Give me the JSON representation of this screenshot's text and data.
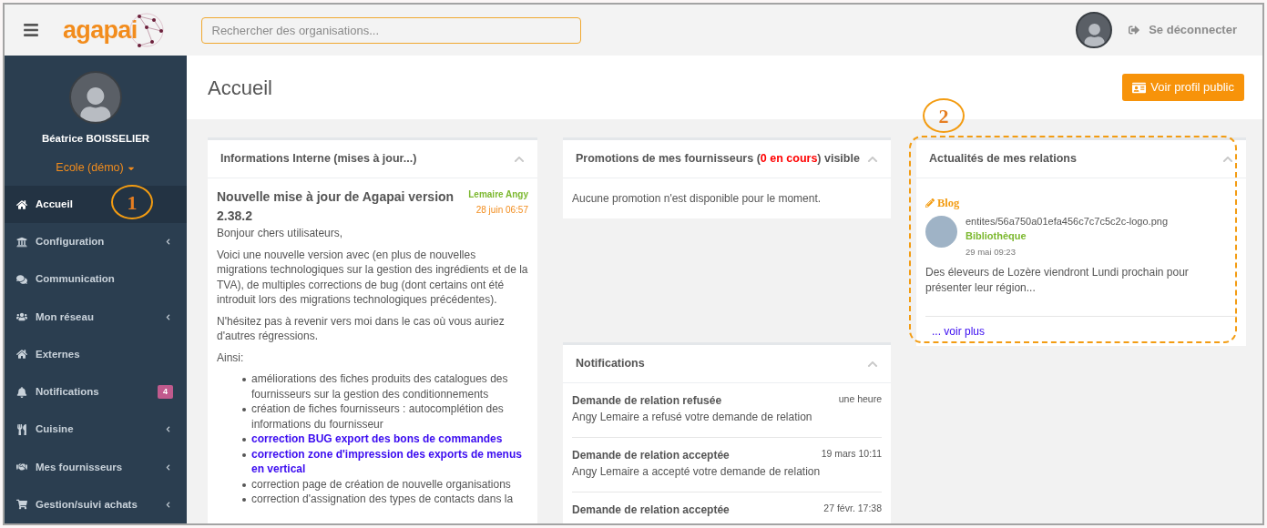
{
  "header": {
    "logo": "agapai",
    "search": {
      "placeholder": "Rechercher des organisations..."
    },
    "logout": "Se déconnecter"
  },
  "sidebar": {
    "user_name": "Béatrice BOISSELIER",
    "organisation": "Ecole (démo)",
    "items": [
      {
        "label": "Accueil",
        "selected": true,
        "expandable": false
      },
      {
        "label": "Configuration",
        "selected": false,
        "expandable": true
      },
      {
        "label": "Communication",
        "selected": false,
        "expandable": false
      },
      {
        "label": "Mon réseau",
        "selected": false,
        "expandable": true
      },
      {
        "label": "Externes",
        "selected": false,
        "expandable": false
      },
      {
        "label": "Notifications",
        "selected": false,
        "expandable": false,
        "badge": "4"
      },
      {
        "label": "Cuisine",
        "selected": false,
        "expandable": true
      },
      {
        "label": "Mes fournisseurs",
        "selected": false,
        "expandable": true
      },
      {
        "label": "Gestion/suivi achats",
        "selected": false,
        "expandable": true
      }
    ]
  },
  "page": {
    "title": "Accueil",
    "public_profile_button": "Voir profil public"
  },
  "internal_info": {
    "title": "Informations Interne (mises à jour...)",
    "post": {
      "title": "Nouvelle mise à jour de Agapai version 2.38.2",
      "author": "Lemaire Angy",
      "date": "28 juin 06:57",
      "paragraphs": [
        "Bonjour chers utilisateurs,",
        "Voici une nouvelle version avec (en plus de nouvelles migrations technologiques sur la gestion des ingrédients et de la TVA), de multiples corrections de bug (dont certains ont été introduit lors des migrations technologiques précédentes).",
        "N'hésitez pas à revenir vers moi dans le cas où vous auriez d'autres régressions.",
        "Ainsi:"
      ],
      "bullets": [
        {
          "text": "améliorations des fiches produits des catalogues des fournisseurs sur la gestion des conditionnements",
          "highlighted": false
        },
        {
          "text": "création de fiches fournisseurs : autocomplétion des informations du fournisseur",
          "highlighted": false
        },
        {
          "text": "correction BUG export des bons de commandes",
          "highlighted": true
        },
        {
          "text": "correction zone d'impression des exports de menus en vertical",
          "highlighted": true
        },
        {
          "text": "correction page de création de nouvelle organisations",
          "highlighted": false
        },
        {
          "text": "correction d'assignation des types de contacts dans la",
          "highlighted": false
        }
      ]
    }
  },
  "promotions": {
    "title": [
      {
        "text": "Promotions de mes fournisseurs (",
        "kind": "plain"
      },
      {
        "text": "0 en cours",
        "kind": "count"
      },
      {
        "text": ") visible",
        "kind": "plain"
      }
    ],
    "empty_message": "Aucune promotion n'est disponible pour le moment."
  },
  "notifications": {
    "title": "Notifications",
    "items": [
      {
        "title": "Demande de relation refusée",
        "time": "une heure",
        "message": "Angy Lemaire a refusé votre demande de relation"
      },
      {
        "title": "Demande de relation acceptée",
        "time": "19 mars 10:11",
        "message": "Angy Lemaire a accepté votre demande de relation"
      },
      {
        "title": "Demande de relation acceptée",
        "time": "27 févr. 17:38"
      }
    ]
  },
  "relations_news": {
    "title": "Actualités de mes relations",
    "post": {
      "category": "Blog",
      "image_name": "entites/56a750a01efa456c7c7c5c2c-logo.png",
      "author": "Bibliothèque",
      "date": "29 mai 09:23",
      "text": "Des éleveurs de Lozère viendront Lundi prochain pour présenter leur région..."
    },
    "more_link": "... voir plus"
  },
  "annotations": [
    {
      "label": "1"
    },
    {
      "label": "2"
    }
  ]
}
